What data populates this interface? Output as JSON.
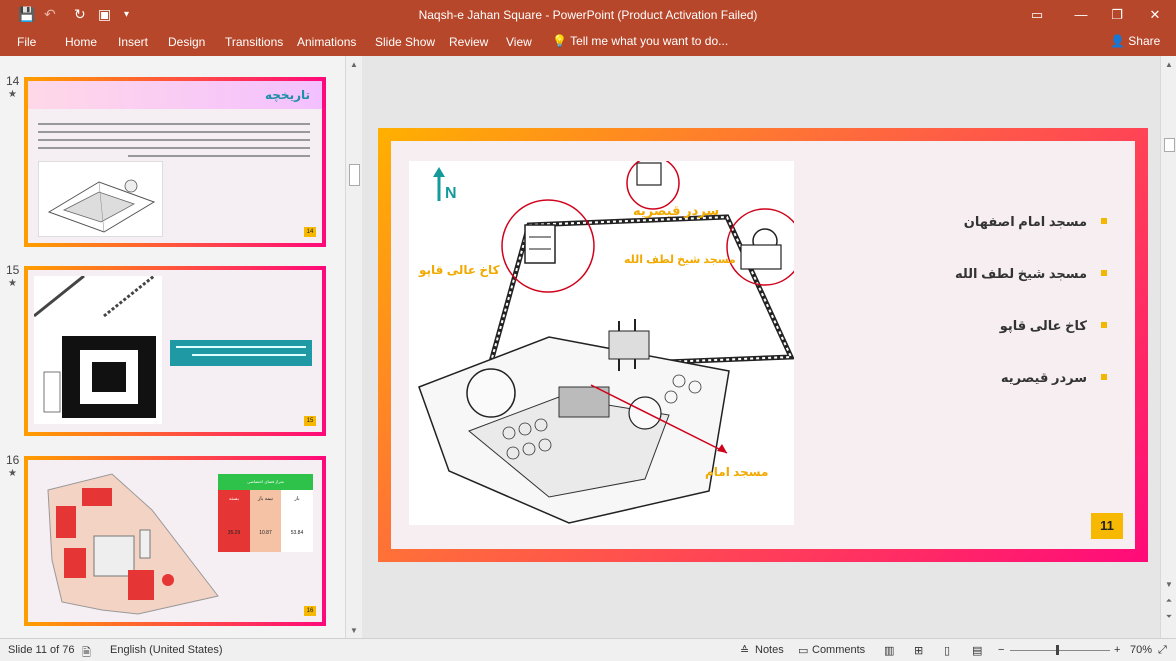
{
  "window": {
    "title": "Naqsh-e Jahan Square  -  PowerPoint (Product Activation Failed)",
    "controls": [
      "▭",
      "—",
      "❐",
      "✕"
    ]
  },
  "ribbon": {
    "tabs": [
      "File",
      "Home",
      "Insert",
      "Design",
      "Transitions",
      "Animations",
      "Slide Show",
      "Review",
      "View"
    ],
    "tell_me": "Tell me what you want to do...",
    "share": "Share"
  },
  "thumbnails": [
    {
      "number": "14",
      "star": "★",
      "title": "تاریخچه",
      "badge": "14"
    },
    {
      "number": "15",
      "star": "★",
      "badge": "15"
    },
    {
      "number": "16",
      "star": "★",
      "table_header": "متراژ فضای اختصاصی",
      "table_cols": [
        "بسته",
        "نیمه باز",
        "باز"
      ],
      "table_values": [
        "35.29",
        "10.87",
        "53.84"
      ],
      "badge": "16"
    }
  ],
  "slide": {
    "plan_labels": {
      "north": "N",
      "gate": "سردر قیصریه",
      "lotfollah": "مسجد شیخ لطف الله",
      "aliqapu": "کاخ عالی قاپو",
      "imam": "مسجد امام"
    },
    "bullets": [
      "مسجد امام اصفهان",
      "مسجد شیخ لطف الله",
      "کاخ عالی قاپو",
      "سردر قیصریه"
    ],
    "number": "11"
  },
  "status": {
    "slide_info": "Slide 11 of 76",
    "language": "English (United States)",
    "notes": "Notes",
    "comments": "Comments",
    "zoom": "70%"
  },
  "colors": {
    "accent": "#b7472a",
    "gradient_start": "#ffb000",
    "gradient_end": "#ff0a7a",
    "badge": "#f6b800",
    "label": "#f2a900",
    "circle": "#d0021b"
  }
}
